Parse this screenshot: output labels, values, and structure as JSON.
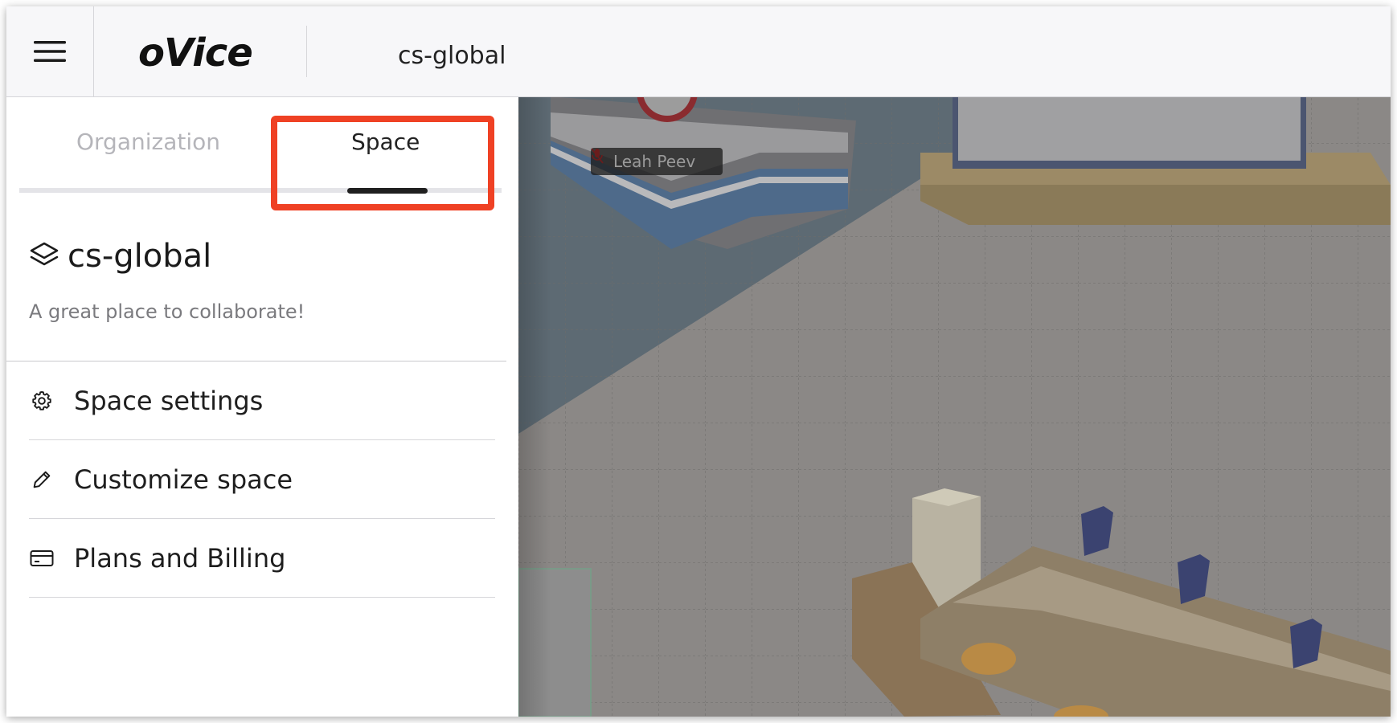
{
  "app": {
    "logo": "oVice",
    "space_title": "cs-global"
  },
  "tabs": [
    {
      "label": "Organization",
      "active": false
    },
    {
      "label": "Space",
      "active": true
    }
  ],
  "space": {
    "name": "cs-global",
    "description": "A great place to collaborate!"
  },
  "menu": [
    {
      "label": "Space settings",
      "icon": "gear-icon"
    },
    {
      "label": "Customize space",
      "icon": "pencil-icon"
    },
    {
      "label": "Plans and Billing",
      "icon": "credit-card-icon"
    }
  ],
  "map": {
    "user_label": "Leah Peev"
  },
  "colors": {
    "highlight": "#ef4124",
    "active_tab_indicator": "#1f1f1f",
    "inactive_tab_text": "#b5b5ba"
  }
}
